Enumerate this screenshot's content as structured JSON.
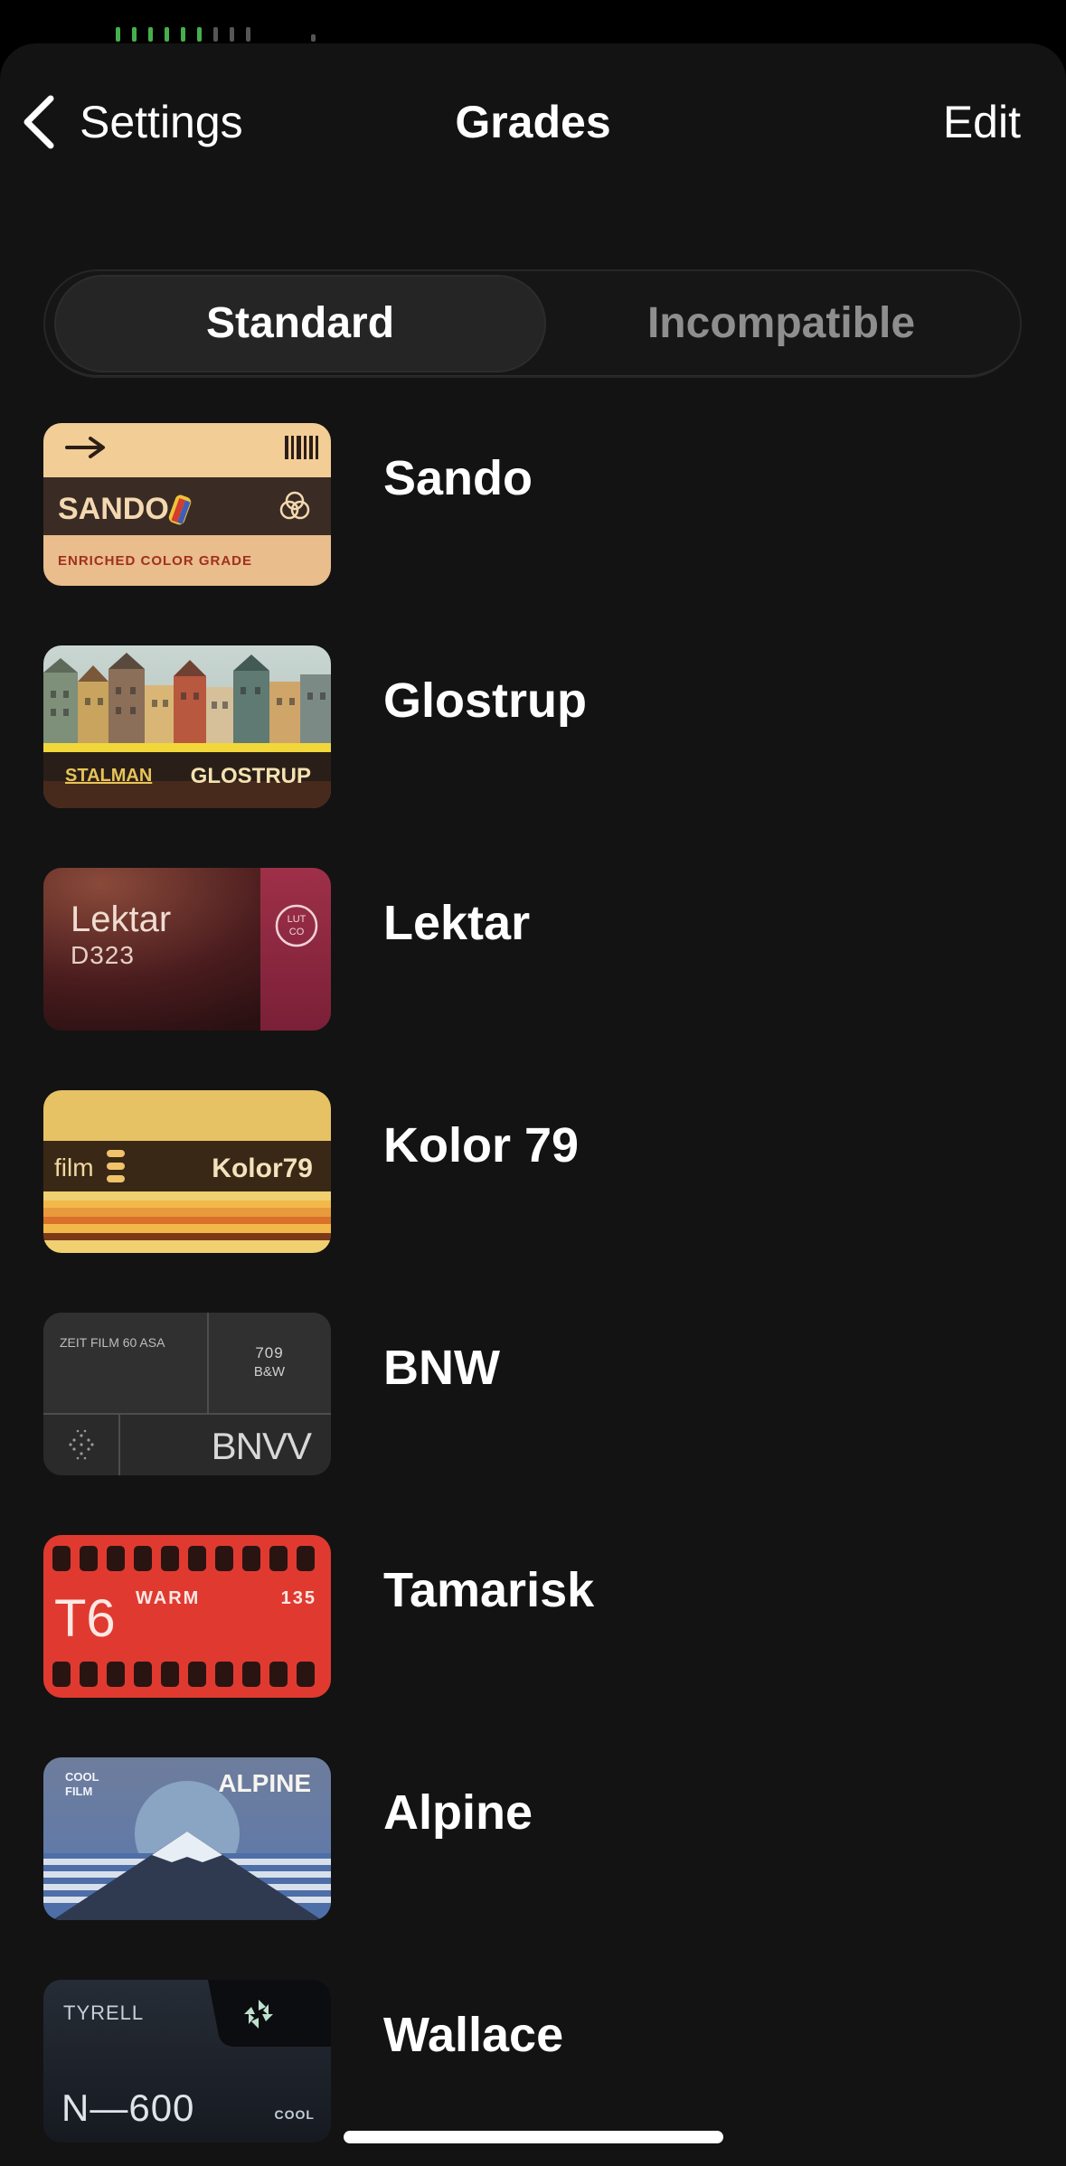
{
  "nav": {
    "back_label": "Settings",
    "title": "Grades",
    "edit_label": "Edit"
  },
  "segments": {
    "standard": "Standard",
    "incompatible": "Incompatible",
    "selected": "Standard"
  },
  "grades": [
    {
      "name": "Sando",
      "card": {
        "title": "SANDO",
        "subtitle": "ENRICHED COLOR GRADE"
      }
    },
    {
      "name": "Glostrup",
      "card": {
        "left": "STALMAN",
        "right": "GLOSTRUP"
      }
    },
    {
      "name": "Lektar",
      "card": {
        "title": "Lektar",
        "subtitle": "D323",
        "badge": "LUT CO"
      }
    },
    {
      "name": "Kolor 79",
      "card": {
        "left": "film",
        "right": "Kolor79"
      }
    },
    {
      "name": "BNW",
      "card": {
        "top_left": "ZEIT FILM 60 ASA",
        "top_right": "709 B&W",
        "title": "BNVV"
      }
    },
    {
      "name": "Tamarisk",
      "card": {
        "title": "T6",
        "tag": "WARM",
        "number": "135"
      }
    },
    {
      "name": "Alpine",
      "card": {
        "left": "COOL FILM",
        "right": "ALPINE"
      }
    },
    {
      "name": "Wallace",
      "card": {
        "top": "TYRELL",
        "title": "N—600",
        "tag": "COOL"
      }
    }
  ],
  "colors": {
    "background": "#131313",
    "segment_active": "#252525",
    "inactive_text": "#8e8e8e"
  }
}
